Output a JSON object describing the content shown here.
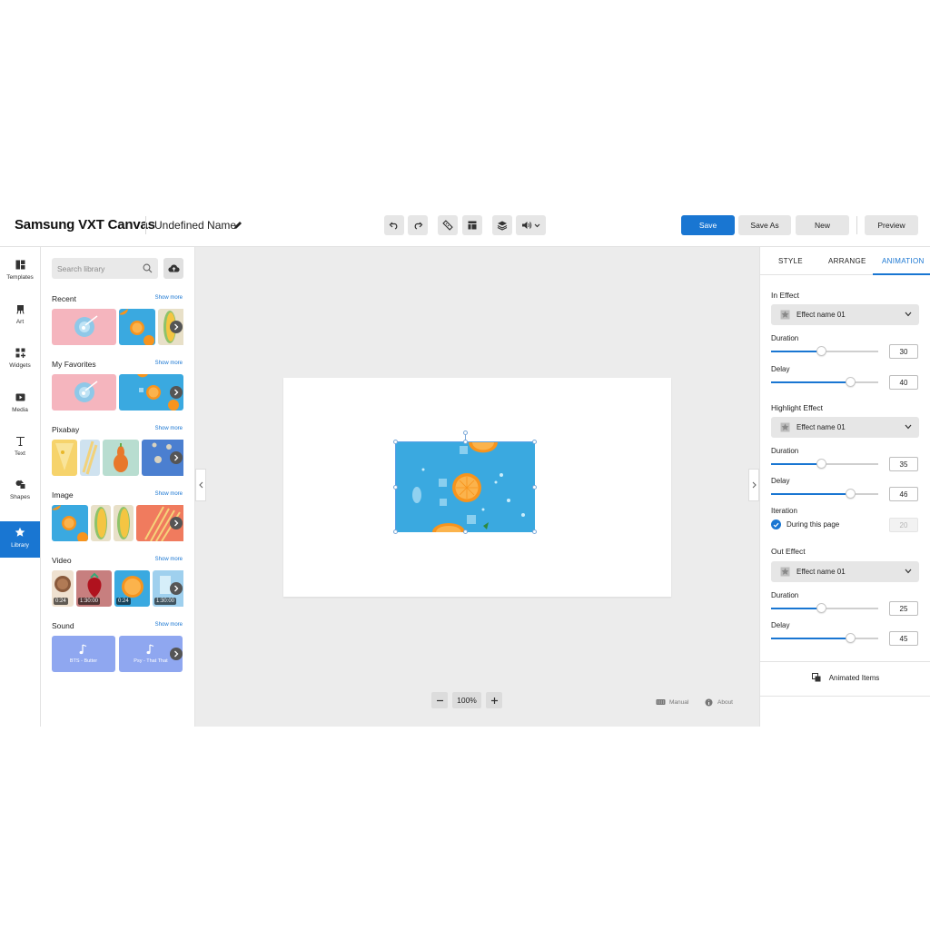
{
  "header": {
    "brand": "Samsung VXT Canvas",
    "doc_name": "Undefined Name",
    "save": "Save",
    "save_as": "Save As",
    "new": "New",
    "preview": "Preview"
  },
  "rail": {
    "items": [
      {
        "label": "Templates",
        "icon": "templates-icon"
      },
      {
        "label": "Art",
        "icon": "art-icon"
      },
      {
        "label": "Widgets",
        "icon": "widgets-icon"
      },
      {
        "label": "Media",
        "icon": "media-icon"
      },
      {
        "label": "Text",
        "icon": "text-icon"
      },
      {
        "label": "Shapes",
        "icon": "shapes-icon"
      },
      {
        "label": "Library",
        "icon": "star-icon",
        "active": true
      }
    ]
  },
  "library": {
    "search_placeholder": "Search library",
    "sections": {
      "recent": {
        "title": "Recent",
        "more": "Show more"
      },
      "favorites": {
        "title": "My Favorites",
        "more": "Show more"
      },
      "pixabay": {
        "title": "Pixabay",
        "more": "Show more"
      },
      "image": {
        "title": "Image",
        "more": "Show more"
      },
      "video": {
        "title": "Video",
        "more": "Show more",
        "durations": [
          "0:24",
          "1:30:00",
          "0:24",
          "1:30:00"
        ]
      },
      "sound": {
        "title": "Sound",
        "more": "Show more",
        "tracks": [
          "BTS - Butter",
          "Psy - That That"
        ]
      }
    }
  },
  "canvas": {
    "zoom": "100%",
    "manual": "Manual",
    "about": "About"
  },
  "panel": {
    "tabs": [
      "STYLE",
      "ARRANGE",
      "ANIMATION"
    ],
    "active_tab": "ANIMATION",
    "in_effect": {
      "title": "In Effect",
      "effect": "Effect name 01",
      "duration_label": "Duration",
      "duration": "30",
      "delay_label": "Delay",
      "delay": "40"
    },
    "highlight_effect": {
      "title": "Highlight Effect",
      "effect": "Effect name 01",
      "duration_label": "Duration",
      "duration": "35",
      "delay_label": "Delay",
      "delay": "46",
      "iteration_label": "Iteration",
      "iteration_check": "During this page",
      "iteration_value": "20"
    },
    "out_effect": {
      "title": "Out Effect",
      "effect": "Effect name 01",
      "duration_label": "Duration",
      "duration": "25",
      "delay_label": "Delay",
      "delay": "45"
    },
    "animated_items": "Animated Items"
  },
  "colors": {
    "accent": "#1976d2",
    "canvas_bg": "#ececec",
    "image_blue": "#3aa9e0",
    "orange": "#f7941d"
  }
}
